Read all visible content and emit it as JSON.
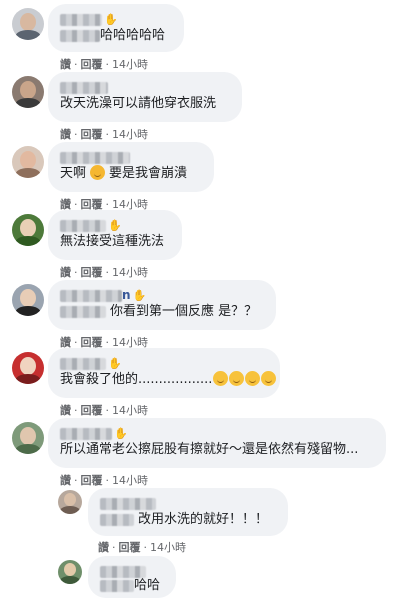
{
  "comments": [
    {
      "name_suffix": "",
      "text": "哈哈哈哈哈",
      "reply_prefix": "",
      "emojis": [],
      "actions": {
        "like": "讚",
        "reply": "回覆",
        "time": "14小時"
      }
    },
    {
      "name_suffix": "",
      "text": "改天洗澡可以請他穿衣服洗",
      "emojis": [],
      "actions": {
        "like": "讚",
        "reply": "回覆",
        "time": "14小時"
      }
    },
    {
      "name_suffix": "",
      "text": "天啊",
      "text2": "要是我會崩潰",
      "emojis": [
        "wow"
      ],
      "actions": {
        "like": "讚",
        "reply": "回覆",
        "time": "14小時"
      }
    },
    {
      "name_suffix": "",
      "text": "無法接受這種洗法",
      "emojis": [],
      "actions": {
        "like": "讚",
        "reply": "回覆",
        "time": "14小時"
      }
    },
    {
      "name_suffix": "n",
      "text": "你看到第一個反應 是？？",
      "emojis": [],
      "actions": {
        "like": "讚",
        "reply": "回覆",
        "time": "14小時"
      }
    },
    {
      "name_suffix": "",
      "text": "我會殺了他的..................",
      "emojis": [
        "smile",
        "smile",
        "smile",
        "smile"
      ],
      "actions": {
        "like": "讚",
        "reply": "回覆",
        "time": "14小時"
      }
    },
    {
      "name_suffix": "",
      "text": "所以通常老公擦屁股有擦就好～還是依然有殘留物...",
      "emojis": [],
      "actions": {
        "like": "讚",
        "reply": "回覆",
        "time": "14小時"
      }
    },
    {
      "name_suffix": "",
      "text": "改用水洗的就好！！！",
      "emojis": [],
      "actions": {
        "like": "讚",
        "reply": "回覆",
        "time": "14小時"
      }
    },
    {
      "name_suffix": "",
      "text": "哈哈",
      "emojis": []
    }
  ],
  "colors": {
    "bubble": "#f0f2f5",
    "name": "#385898",
    "meta": "#65676b",
    "text": "#1c1e21"
  }
}
